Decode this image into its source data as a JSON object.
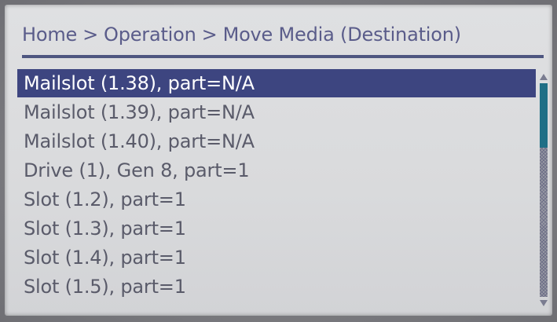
{
  "breadcrumb": {
    "items": [
      "Home",
      "Operation",
      "Move Media (Destination)"
    ],
    "separator": ">"
  },
  "destination_list": {
    "selected_index": 0,
    "items": [
      "Mailslot (1.38), part=N/A",
      "Mailslot (1.39), part=N/A",
      "Mailslot (1.40), part=N/A",
      "Drive (1), Gen 8, part=1",
      "Slot (1.2), part=1",
      "Slot (1.3), part=1",
      "Slot (1.4), part=1",
      "Slot (1.5), part=1"
    ]
  },
  "scrollbar": {
    "position_fraction": 0.0,
    "visible_fraction": 0.3
  },
  "icons": {
    "scroll_up": "arrow-up-icon",
    "scroll_down": "arrow-down-icon"
  },
  "colors": {
    "selection": "#3d4580",
    "text": "#5a5b6a",
    "breadcrumb": "#5a5c8a",
    "scroll_thumb": "#1f6f86"
  }
}
